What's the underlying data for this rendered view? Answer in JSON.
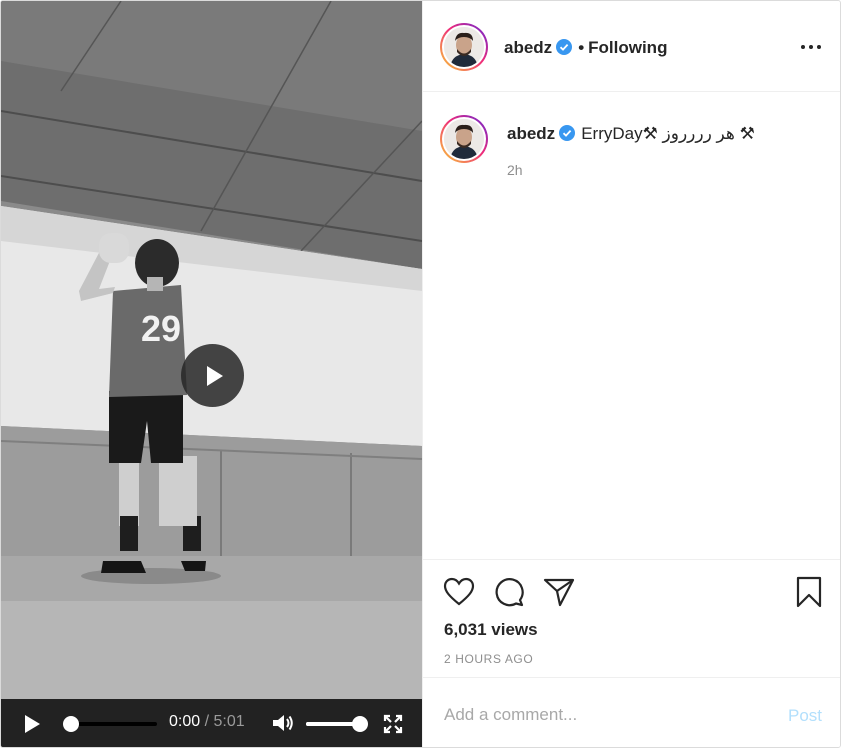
{
  "post": {
    "username": "abedz",
    "follow_status": "Following",
    "separator": "•",
    "caption": "ErryDay⚒ هر رررروز ⚒",
    "caption_age": "2h",
    "views": "6,031 views",
    "timestamp": "2 HOURS AGO",
    "jersey_number": "29"
  },
  "video": {
    "current_time": "0:00",
    "time_separator": "/",
    "duration": "5:01",
    "progress": 0,
    "volume": 1.0
  },
  "comment": {
    "placeholder": "Add a comment...",
    "post_label": "Post"
  },
  "colors": {
    "verified": "#3897f0",
    "post_disabled": "#b2dffc",
    "muted_text": "#8e8e8e"
  },
  "icons": [
    "heart-icon",
    "comment-icon",
    "share-icon",
    "bookmark-icon",
    "more-icon",
    "verified-badge-icon",
    "play-icon",
    "volume-icon",
    "fullscreen-icon"
  ]
}
